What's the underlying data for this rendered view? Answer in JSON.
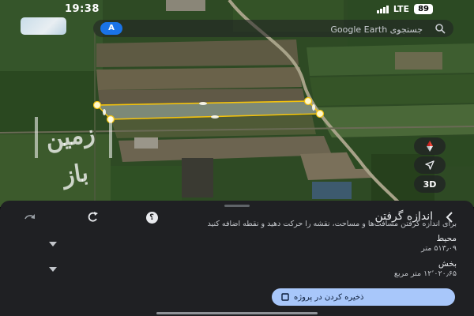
{
  "status_bar": {
    "time": "19:38",
    "network": "LTE",
    "battery": "89"
  },
  "search": {
    "placeholder": "جستجوی Google Earth",
    "account_initial": "A"
  },
  "watermark": {
    "text": "زمین باز"
  },
  "map_controls": {
    "compass_icon": "compass-icon",
    "location_icon": "location-arrow-icon",
    "three_d_label": "3D"
  },
  "panel": {
    "title": "اندازه گرفتن",
    "help_label": "؟",
    "instruction": "برای اندازه گرفتن مسافت‌ها و مساحت، نقشه را حرکت دهید و نقطه اضافه کنید",
    "perimeter": {
      "label": "محیط",
      "value": "۵۱۳٫۰۹ متر"
    },
    "area": {
      "label": "بخش",
      "value": "۱۲٬۰۲۰٫۶۵ متر مربع"
    },
    "save_label": "ذخیره کردن در پروژه"
  },
  "colors": {
    "panel_bg": "#1f2023",
    "accent_button": "#a8c7fa",
    "polygon_stroke": "#f4c20d",
    "account_blue": "#1a73e8"
  }
}
